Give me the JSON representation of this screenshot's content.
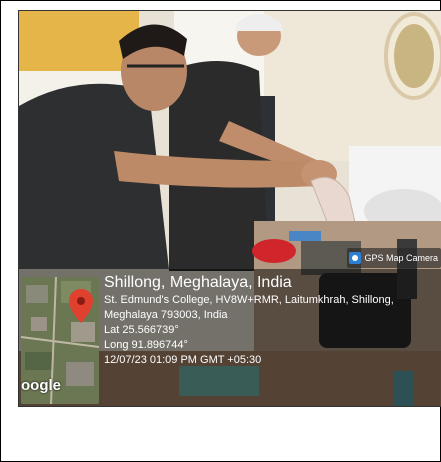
{
  "gps_tag": {
    "label": "GPS Map Camera",
    "icon": "camera-icon"
  },
  "location": {
    "city": "Shillong, Meghalaya, India",
    "address_line1": "St. Edmund's College, HV8W+RMR, Laitumkhrah, Shillong,",
    "address_line2": "Meghalaya 793003, India",
    "latitude": "Lat 25.566739°",
    "longitude": "Long 91.896744°",
    "timestamp": "12/07/23 01:09 PM GMT +05:30"
  },
  "map": {
    "brand": "oogle",
    "pin_icon": "map-pin-icon",
    "pin_color": "#e0412f"
  }
}
